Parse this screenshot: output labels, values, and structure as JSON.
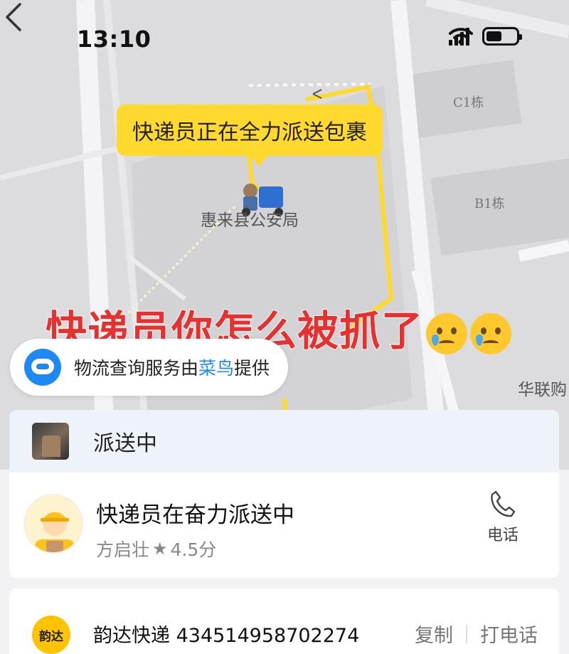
{
  "status_bar": {
    "time": "13:10"
  },
  "map": {
    "bubble_text": "快递员正在全力派送包裹",
    "poi_police": "惠来县公安局",
    "poi_mall": "华联购",
    "building_c1": "C1栋",
    "building_b1": "B1栋",
    "route_color": "#ffd92e"
  },
  "overlay_caption": "快递员你怎么被抓了",
  "provider": {
    "prefix": "物流查询服务由",
    "brand": "菜鸟",
    "suffix": "提供",
    "brand_color": "#1e88f5"
  },
  "status_card": {
    "status": "派送中",
    "courier_title": "快递员在奋力派送中",
    "courier_name": "方启壮",
    "rating": "4.5分",
    "call_label": "电话"
  },
  "tracking": {
    "logo_text": "韵达",
    "carrier": "韵达快递",
    "number": "434514958702274",
    "copy_label": "复制",
    "call_label": "打电话"
  }
}
